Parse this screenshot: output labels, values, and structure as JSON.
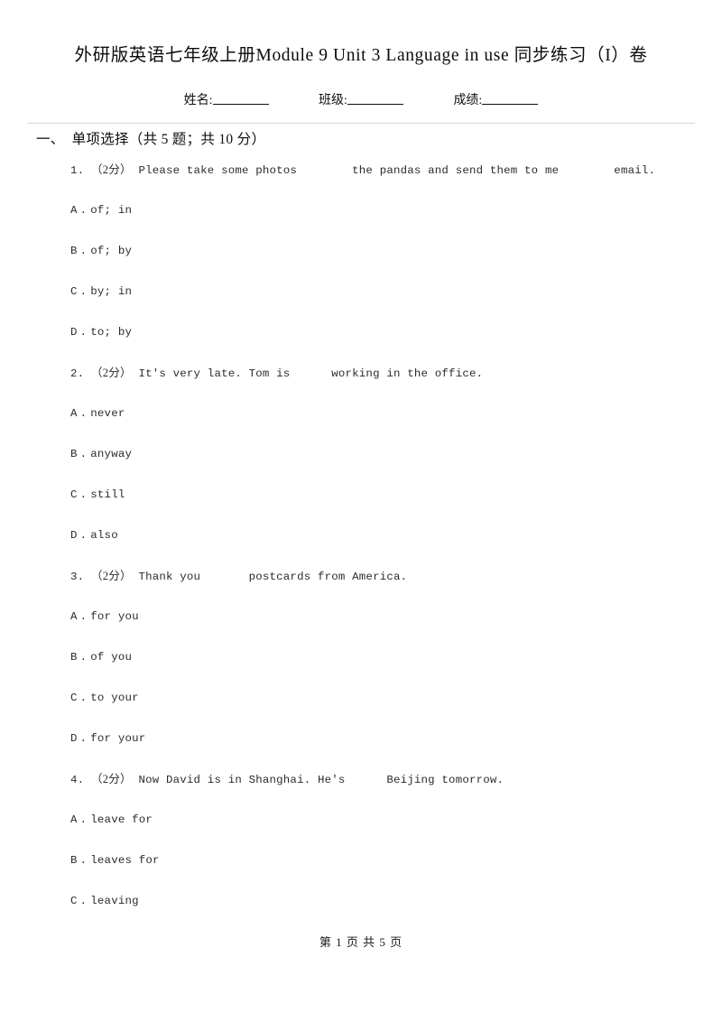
{
  "document": {
    "title": "外研版英语七年级上册Module 9 Unit 3 Language in use 同步练习（I）卷"
  },
  "identity": {
    "fields": [
      {
        "label": "姓名:",
        "value": ""
      },
      {
        "label": "班级:",
        "value": ""
      },
      {
        "label": "成绩:",
        "value": ""
      }
    ]
  },
  "sections": [
    {
      "number": "一、",
      "title": "单项选择（共 5 题；共 10 分）",
      "questions": [
        {
          "index": "1.",
          "points": "（2分）",
          "stem": "Please take some photos        the pandas and send them to me        email.",
          "options": [
            {
              "letter": "A",
              "dot": ".",
              "text": "of; in"
            },
            {
              "letter": "B",
              "dot": ".",
              "text": "of; by"
            },
            {
              "letter": "C",
              "dot": ".",
              "text": "by; in"
            },
            {
              "letter": "D",
              "dot": ".",
              "text": "to; by"
            }
          ]
        },
        {
          "index": "2.",
          "points": "（2分）",
          "stem": "It's very late. Tom is      working in the office.",
          "options": [
            {
              "letter": "A",
              "dot": ".",
              "text": "never"
            },
            {
              "letter": "B",
              "dot": ".",
              "text": "anyway"
            },
            {
              "letter": "C",
              "dot": ".",
              "text": "still"
            },
            {
              "letter": "D",
              "dot": ".",
              "text": "also"
            }
          ]
        },
        {
          "index": "3.",
          "points": "（2分）",
          "stem": "Thank you       postcards from America.",
          "options": [
            {
              "letter": "A",
              "dot": ".",
              "text": "for you"
            },
            {
              "letter": "B",
              "dot": ".",
              "text": "of you"
            },
            {
              "letter": "C",
              "dot": ".",
              "text": "to your"
            },
            {
              "letter": "D",
              "dot": ".",
              "text": "for your"
            }
          ]
        },
        {
          "index": "4.",
          "points": "（2分）",
          "stem": "Now David is in Shanghai. He's      Beijing tomorrow.",
          "options": [
            {
              "letter": "A",
              "dot": ".",
              "text": "leave for"
            },
            {
              "letter": "B",
              "dot": ".",
              "text": "leaves for"
            },
            {
              "letter": "C",
              "dot": ".",
              "text": "leaving"
            }
          ]
        }
      ]
    }
  ],
  "footer": {
    "page_text": "第 1 页 共 5 页"
  }
}
